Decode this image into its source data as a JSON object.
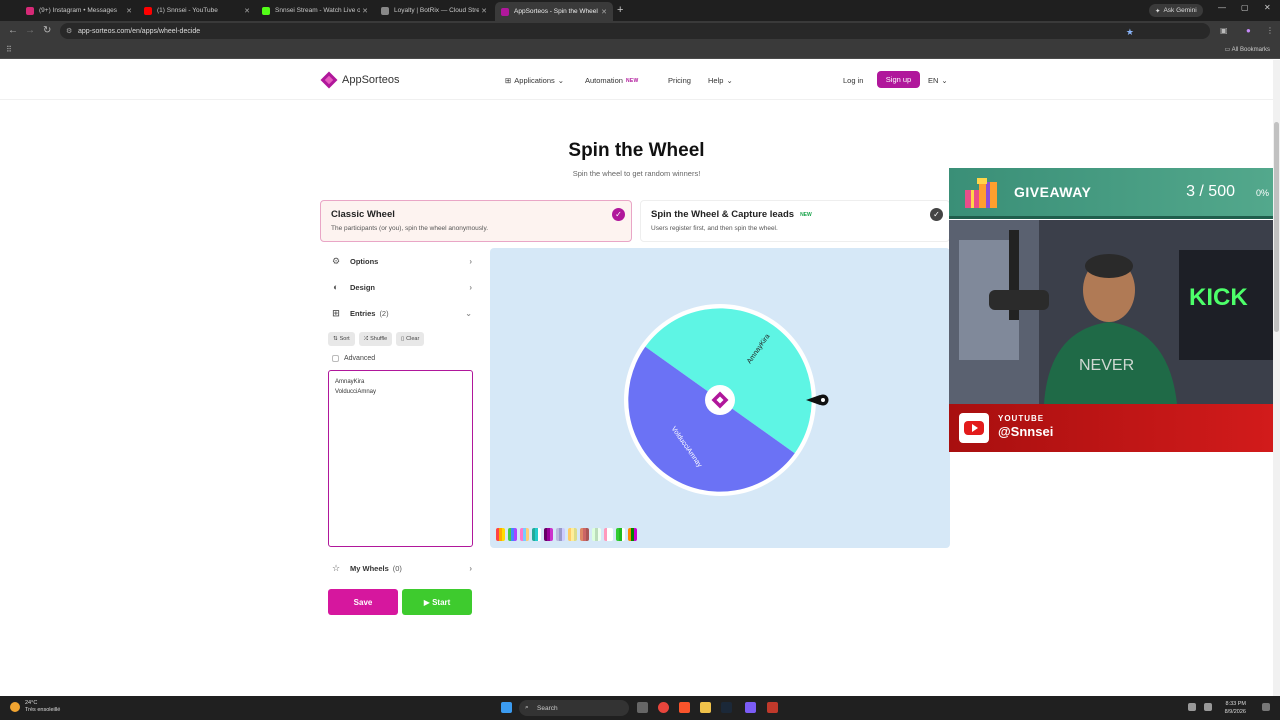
{
  "browser": {
    "tabs": [
      {
        "title": "(9+) Instagram • Messages",
        "color": "#d62976"
      },
      {
        "title": "(1) Snnsei - YouTube",
        "color": "#ff0000"
      },
      {
        "title": "Snnsei Stream - Watch Live on Kick",
        "color": "#53fc18"
      },
      {
        "title": "Loyalty | BotRix — Cloud Stream",
        "color": "#888888"
      },
      {
        "title": "AppSorteos - Spin the Wheel Onli",
        "color": "#b0179b"
      }
    ],
    "ask_gemini": "Ask Gemini",
    "url": "app-sorteos.com/en/apps/wheel-decide",
    "all_bookmarks": "All Bookmarks"
  },
  "site": {
    "logo_text": "AppSorteos",
    "nav": {
      "applications": "Applications",
      "automation": "Automation",
      "automation_badge": "NEW",
      "pricing": "Pricing",
      "help": "Help",
      "login": "Log in",
      "signup": "Sign up",
      "lang": "EN"
    },
    "title": "Spin the Wheel",
    "subtitle": "Spin the wheel to get random winners!",
    "modes": [
      {
        "title": "Classic Wheel",
        "desc": "The participants (or you), spin the wheel anonymously.",
        "badge": ""
      },
      {
        "title": "Spin the Wheel & Capture leads",
        "desc": "Users register first, and then spin the wheel.",
        "badge": "NEW"
      }
    ],
    "sidebar": {
      "options": "Options",
      "design": "Design",
      "entries": "Entries",
      "entries_count": "(2)",
      "sort": "Sort",
      "shuffle": "Shuffle",
      "clear": "Clear",
      "advanced": "Advanced",
      "entries_list": [
        "AmnayKira",
        "VolducciAmnay"
      ],
      "my_wheels": "My Wheels",
      "my_wheels_count": "(0)",
      "save": "Save",
      "start": "Start"
    },
    "wheel": {
      "segments": [
        {
          "label": "AmnayKira",
          "color": "#5ef5e4"
        },
        {
          "label": "VolducciAmnay",
          "color": "#6b72f5"
        }
      ]
    }
  },
  "overlay": {
    "giveaway_label": "GIVEAWAY",
    "count": "3 / 500",
    "percent": "0%",
    "platform": "YOUTUBE",
    "handle": "@Snnsei"
  },
  "taskbar": {
    "temp": "24°C",
    "weather": "Très ensoleillé",
    "search": "Search",
    "time": "8:33 PM",
    "date": "8/9/2026"
  },
  "colors": {
    "brand": "#b0179b",
    "start_green": "#3ecb2e",
    "stage_bg": "#d6e8f7"
  }
}
